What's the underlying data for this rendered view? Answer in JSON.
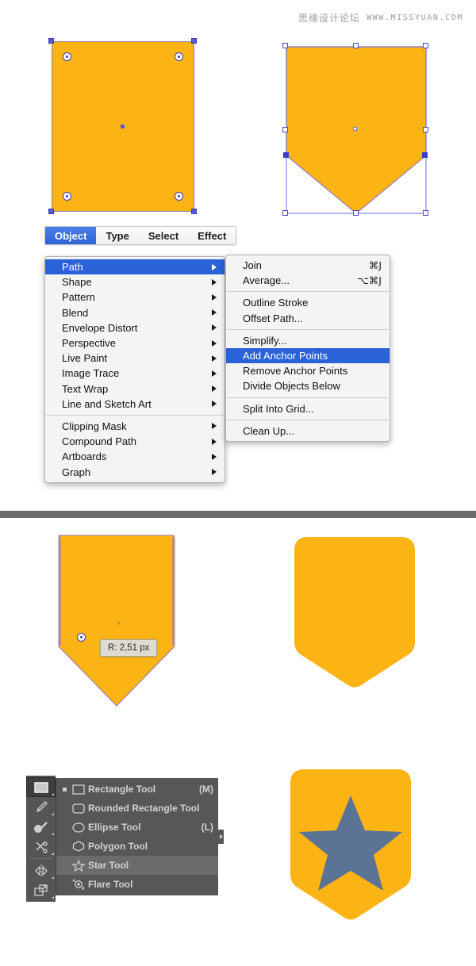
{
  "watermark": {
    "site_cn": "思缘设计论坛",
    "site_url": "WWW.MISSYUAN.COM"
  },
  "colors": {
    "shape_fill": "#fcb415",
    "star_fill": "#5b7496",
    "selection_blue": "#5a5ad2",
    "menu_highlight": "#2a62d8",
    "panel_gray": "#575757",
    "divider_gray": "#6d6d6d"
  },
  "menubar": {
    "items": [
      {
        "label": "Object",
        "active": true
      },
      {
        "label": "Type",
        "active": false
      },
      {
        "label": "Select",
        "active": false
      },
      {
        "label": "Effect",
        "active": false
      }
    ]
  },
  "object_menu": {
    "items": [
      {
        "label": "Path",
        "submenu": true,
        "highlighted": true
      },
      {
        "label": "Shape",
        "submenu": true,
        "highlighted": false
      },
      {
        "label": "Pattern",
        "submenu": true,
        "highlighted": false
      },
      {
        "label": "Blend",
        "submenu": true,
        "highlighted": false
      },
      {
        "label": "Envelope Distort",
        "submenu": true,
        "highlighted": false
      },
      {
        "label": "Perspective",
        "submenu": true,
        "highlighted": false
      },
      {
        "label": "Live Paint",
        "submenu": true,
        "highlighted": false
      },
      {
        "label": "Image Trace",
        "submenu": true,
        "highlighted": false
      },
      {
        "label": "Text Wrap",
        "submenu": true,
        "highlighted": false
      },
      {
        "label": "Line and Sketch Art",
        "submenu": true,
        "highlighted": false
      },
      {
        "separator": true
      },
      {
        "label": "Clipping Mask",
        "submenu": true,
        "highlighted": false
      },
      {
        "label": "Compound Path",
        "submenu": true,
        "highlighted": false
      },
      {
        "label": "Artboards",
        "submenu": true,
        "highlighted": false
      },
      {
        "label": "Graph",
        "submenu": true,
        "highlighted": false
      }
    ]
  },
  "path_submenu": {
    "items": [
      {
        "label": "Join",
        "shortcut": "⌘J",
        "highlighted": false
      },
      {
        "label": "Average...",
        "shortcut": "⌥⌘J",
        "highlighted": false
      },
      {
        "separator": true
      },
      {
        "label": "Outline Stroke",
        "shortcut": "",
        "highlighted": false
      },
      {
        "label": "Offset Path...",
        "shortcut": "",
        "highlighted": false
      },
      {
        "separator": true
      },
      {
        "label": "Simplify...",
        "shortcut": "",
        "highlighted": false
      },
      {
        "label": "Add Anchor Points",
        "shortcut": "",
        "highlighted": true
      },
      {
        "label": "Remove Anchor Points",
        "shortcut": "",
        "highlighted": false
      },
      {
        "label": "Divide Objects Below",
        "shortcut": "",
        "highlighted": false
      },
      {
        "separator": true
      },
      {
        "label": "Split Into Grid...",
        "shortcut": "",
        "highlighted": false
      },
      {
        "separator": true
      },
      {
        "label": "Clean Up...",
        "shortcut": "",
        "highlighted": false
      }
    ]
  },
  "radius_tooltip": {
    "text": "R: 2,51 px"
  },
  "toolbar": {
    "tools": [
      {
        "name": "rectangle-tool",
        "selected": true
      },
      {
        "name": "paintbrush-tool",
        "selected": false
      },
      {
        "name": "blob-brush-tool",
        "selected": false
      },
      {
        "name": "scissors-tool",
        "selected": false
      },
      {
        "name": "reflect-tool",
        "selected": false
      },
      {
        "name": "free-transform-tool",
        "selected": false
      }
    ]
  },
  "shape_flyout": {
    "items": [
      {
        "label": "Rectangle Tool",
        "key": "(M)",
        "icon": "rectangle-icon",
        "selected": false,
        "active_mark": true
      },
      {
        "label": "Rounded Rectangle Tool",
        "key": "",
        "icon": "rounded-rectangle-icon",
        "selected": false,
        "active_mark": false
      },
      {
        "label": "Ellipse Tool",
        "key": "(L)",
        "icon": "ellipse-icon",
        "selected": false,
        "active_mark": false
      },
      {
        "label": "Polygon Tool",
        "key": "",
        "icon": "polygon-icon",
        "selected": false,
        "active_mark": false
      },
      {
        "label": "Star Tool",
        "key": "",
        "icon": "star-icon",
        "selected": true,
        "active_mark": false
      },
      {
        "label": "Flare Tool",
        "key": "",
        "icon": "flare-icon",
        "selected": false,
        "active_mark": false
      }
    ]
  }
}
